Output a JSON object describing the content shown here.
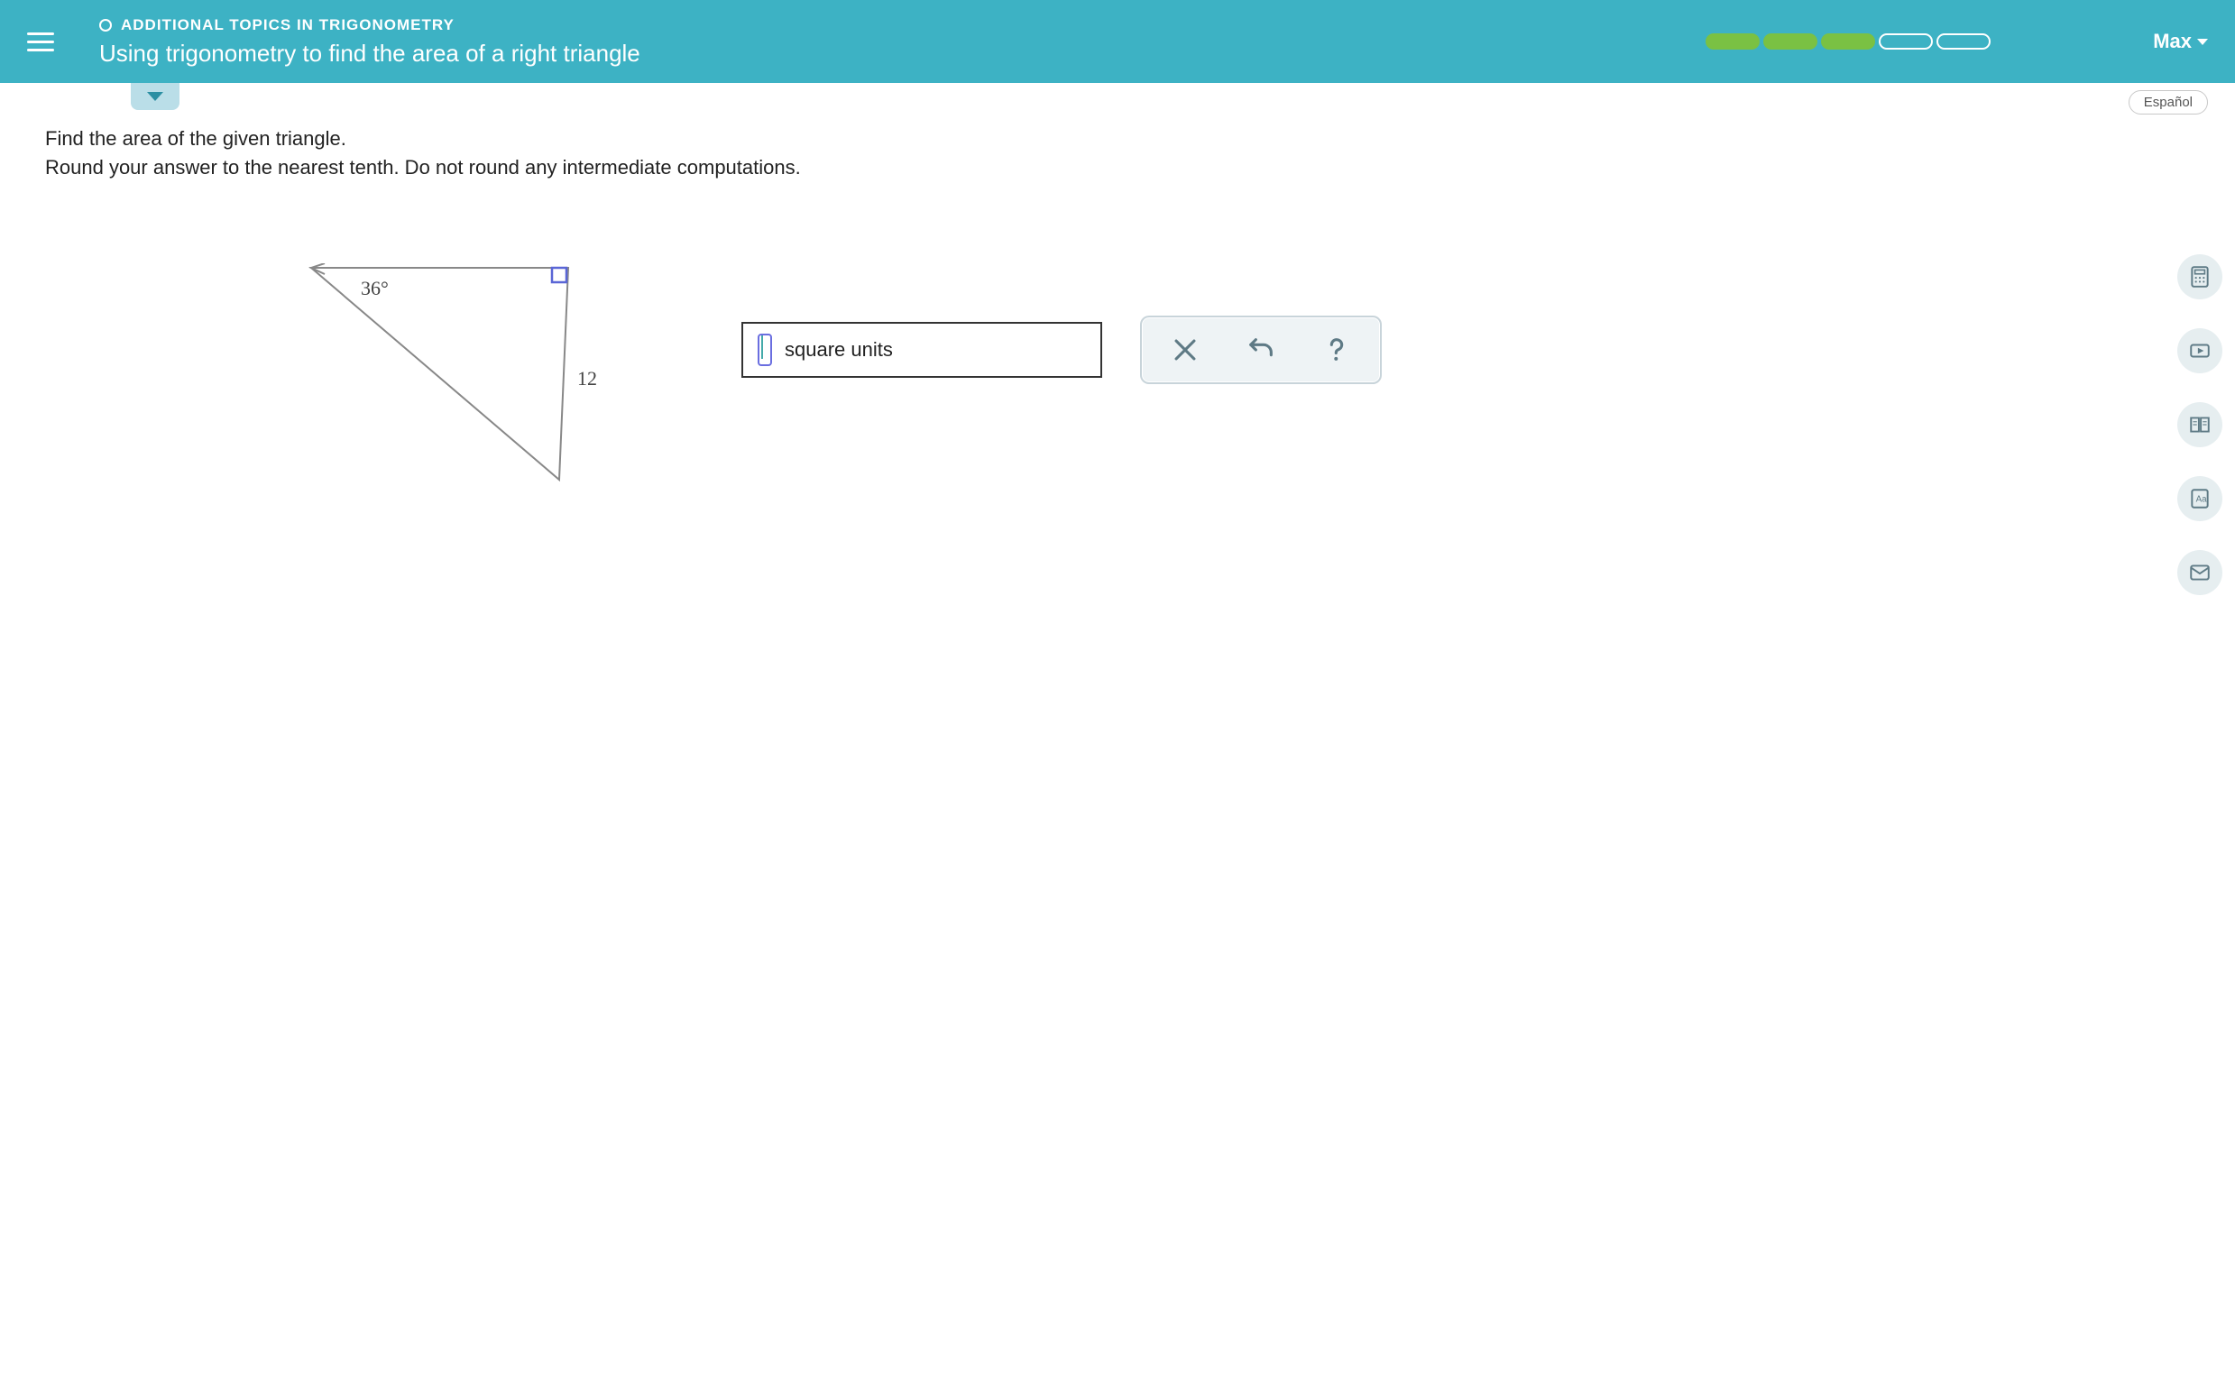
{
  "header": {
    "breadcrumb": "ADDITIONAL TOPICS IN TRIGONOMETRY",
    "title": "Using trigonometry to find the area of a right triangle",
    "user": "Max",
    "progress": [
      true,
      true,
      true,
      false,
      false
    ]
  },
  "language_button": "Español",
  "problem": {
    "line1": "Find the area of the given triangle.",
    "line2": "Round your answer to the nearest tenth. Do not round any intermediate computations."
  },
  "triangle": {
    "angle_label": "36°",
    "side_label": "12"
  },
  "answer": {
    "units_label": "square units",
    "value": ""
  },
  "side_tools": {
    "calculator": "calculator-icon",
    "video": "video-icon",
    "textbook": "textbook-icon",
    "glossary": "glossary-icon",
    "message": "message-icon"
  }
}
